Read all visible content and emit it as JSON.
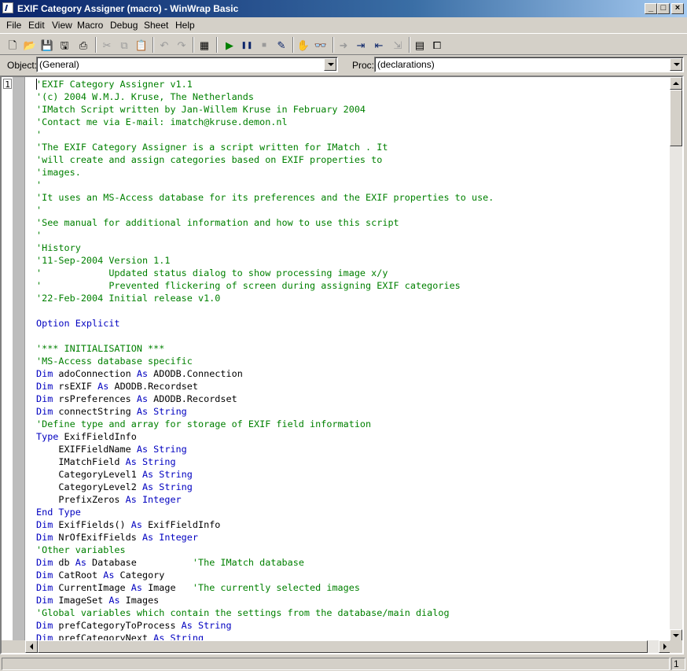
{
  "window": {
    "title": "EXIF Category Assigner (macro) - WinWrap Basic",
    "minimize_glyph": "_",
    "maximize_glyph": "□",
    "close_glyph": "×"
  },
  "menu": [
    "File",
    "Edit",
    "View",
    "Macro",
    "Debug",
    "Sheet",
    "Help"
  ],
  "toolbar": [
    {
      "icon": "new-file-icon",
      "glyph": "🗋",
      "enabled": true
    },
    {
      "icon": "open-folder-icon",
      "glyph": "📂",
      "enabled": true
    },
    {
      "icon": "save-icon",
      "glyph": "💾",
      "enabled": true
    },
    {
      "icon": "save-all-icon",
      "glyph": "🖫",
      "enabled": true
    },
    {
      "icon": "print-icon",
      "glyph": "⎙",
      "enabled": true
    },
    {
      "icon": "cut-icon",
      "glyph": "✂",
      "enabled": false
    },
    {
      "icon": "copy-icon",
      "glyph": "⧉",
      "enabled": false
    },
    {
      "icon": "paste-icon",
      "glyph": "📋",
      "enabled": false
    },
    {
      "icon": "undo-icon",
      "glyph": "↶",
      "enabled": false
    },
    {
      "icon": "redo-icon",
      "glyph": "↷",
      "enabled": false
    },
    {
      "icon": "user-dialog-icon",
      "glyph": "▦",
      "enabled": true
    },
    {
      "icon": "run-icon",
      "glyph": "▶",
      "enabled": true
    },
    {
      "icon": "pause-icon",
      "glyph": "❚❚",
      "enabled": true
    },
    {
      "icon": "stop-icon",
      "glyph": "■",
      "enabled": false
    },
    {
      "icon": "toggle-breakpoint-icon",
      "glyph": "✎",
      "enabled": true
    },
    {
      "icon": "hand-icon",
      "glyph": "✋",
      "enabled": true
    },
    {
      "icon": "quick-watch-icon",
      "glyph": "👓",
      "enabled": true
    },
    {
      "icon": "step-into-icon",
      "glyph": "➜",
      "enabled": false
    },
    {
      "icon": "step-over-icon",
      "glyph": "⇥",
      "enabled": true
    },
    {
      "icon": "step-out-icon",
      "glyph": "⇤",
      "enabled": true
    },
    {
      "icon": "step-to-cursor-icon",
      "glyph": "⇲",
      "enabled": false
    },
    {
      "icon": "dialog-editor-icon",
      "glyph": "▤",
      "enabled": true
    },
    {
      "icon": "references-icon",
      "glyph": "⧠",
      "enabled": true
    }
  ],
  "selectors": {
    "object_label": "Object:",
    "object_value": "(General)",
    "proc_label": "Proc:",
    "proc_value": "(declarations)"
  },
  "editor": {
    "line_number": "1",
    "lines": [
      [
        {
          "t": "'EXIF Category Assigner v1.1",
          "c": "cm"
        }
      ],
      [
        {
          "t": "'(c) 2004 W.M.J. Kruse, The Netherlands",
          "c": "cm"
        }
      ],
      [
        {
          "t": "'IMatch Script written by Jan-Willem Kruse in February 2004",
          "c": "cm"
        }
      ],
      [
        {
          "t": "'Contact me via E-mail: imatch@kruse.demon.nl",
          "c": "cm"
        }
      ],
      [
        {
          "t": "'",
          "c": "cm"
        }
      ],
      [
        {
          "t": "'The EXIF Category Assigner is a script written for IMatch . It",
          "c": "cm"
        }
      ],
      [
        {
          "t": "'will create and assign categories based on EXIF properties to",
          "c": "cm"
        }
      ],
      [
        {
          "t": "'images.",
          "c": "cm"
        }
      ],
      [
        {
          "t": "'",
          "c": "cm"
        }
      ],
      [
        {
          "t": "'It uses an MS-Access database for its preferences and the EXIF properties to use.",
          "c": "cm"
        }
      ],
      [
        {
          "t": "'",
          "c": "cm"
        }
      ],
      [
        {
          "t": "'See manual for additional information and how to use this script",
          "c": "cm"
        }
      ],
      [
        {
          "t": "'",
          "c": "cm"
        }
      ],
      [
        {
          "t": "'History",
          "c": "cm"
        }
      ],
      [
        {
          "t": "'11-Sep-2004 Version 1.1",
          "c": "cm"
        }
      ],
      [
        {
          "t": "'            Updated status dialog to show processing image x/y",
          "c": "cm"
        }
      ],
      [
        {
          "t": "'            Prevented flickering of screen during assigning EXIF categories",
          "c": "cm"
        }
      ],
      [
        {
          "t": "'22-Feb-2004 Initial release v1.0",
          "c": "cm"
        }
      ],
      [],
      [
        {
          "t": "Option Explicit",
          "c": "kw"
        }
      ],
      [],
      [
        {
          "t": "'*** INITIALISATION ***",
          "c": "cm"
        }
      ],
      [
        {
          "t": "'MS-Access database specific",
          "c": "cm"
        }
      ],
      [
        {
          "t": "Dim",
          "c": "kw"
        },
        {
          "t": " adoConnection ",
          "c": "tx"
        },
        {
          "t": "As",
          "c": "kw"
        },
        {
          "t": " ADODB.Connection",
          "c": "tx"
        }
      ],
      [
        {
          "t": "Dim",
          "c": "kw"
        },
        {
          "t": " rsEXIF ",
          "c": "tx"
        },
        {
          "t": "As",
          "c": "kw"
        },
        {
          "t": " ADODB.Recordset",
          "c": "tx"
        }
      ],
      [
        {
          "t": "Dim",
          "c": "kw"
        },
        {
          "t": " rsPreferences ",
          "c": "tx"
        },
        {
          "t": "As",
          "c": "kw"
        },
        {
          "t": " ADODB.Recordset",
          "c": "tx"
        }
      ],
      [
        {
          "t": "Dim",
          "c": "kw"
        },
        {
          "t": " connectString ",
          "c": "tx"
        },
        {
          "t": "As String",
          "c": "kw"
        }
      ],
      [
        {
          "t": "'Define type and array for storage of EXIF field information",
          "c": "cm"
        }
      ],
      [
        {
          "t": "Type",
          "c": "kw"
        },
        {
          "t": " ExifFieldInfo",
          "c": "tx"
        }
      ],
      [
        {
          "t": "    EXIFFieldName ",
          "c": "tx"
        },
        {
          "t": "As String",
          "c": "kw"
        }
      ],
      [
        {
          "t": "    IMatchField ",
          "c": "tx"
        },
        {
          "t": "As String",
          "c": "kw"
        }
      ],
      [
        {
          "t": "    CategoryLevel1 ",
          "c": "tx"
        },
        {
          "t": "As String",
          "c": "kw"
        }
      ],
      [
        {
          "t": "    CategoryLevel2 ",
          "c": "tx"
        },
        {
          "t": "As String",
          "c": "kw"
        }
      ],
      [
        {
          "t": "    PrefixZeros ",
          "c": "tx"
        },
        {
          "t": "As Integer",
          "c": "kw"
        }
      ],
      [
        {
          "t": "End Type",
          "c": "kw"
        }
      ],
      [
        {
          "t": "Dim",
          "c": "kw"
        },
        {
          "t": " ExifFields() ",
          "c": "tx"
        },
        {
          "t": "As",
          "c": "kw"
        },
        {
          "t": " ExifFieldInfo",
          "c": "tx"
        }
      ],
      [
        {
          "t": "Dim",
          "c": "kw"
        },
        {
          "t": " NrOfExifFields ",
          "c": "tx"
        },
        {
          "t": "As Integer",
          "c": "kw"
        }
      ],
      [
        {
          "t": "'Other variables",
          "c": "cm"
        }
      ],
      [
        {
          "t": "Dim",
          "c": "kw"
        },
        {
          "t": " db ",
          "c": "tx"
        },
        {
          "t": "As",
          "c": "kw"
        },
        {
          "t": " Database          ",
          "c": "tx"
        },
        {
          "t": "'The IMatch database",
          "c": "cm"
        }
      ],
      [
        {
          "t": "Dim",
          "c": "kw"
        },
        {
          "t": " CatRoot ",
          "c": "tx"
        },
        {
          "t": "As",
          "c": "kw"
        },
        {
          "t": " Category",
          "c": "tx"
        }
      ],
      [
        {
          "t": "Dim",
          "c": "kw"
        },
        {
          "t": " CurrentImage ",
          "c": "tx"
        },
        {
          "t": "As",
          "c": "kw"
        },
        {
          "t": " Image   ",
          "c": "tx"
        },
        {
          "t": "'The currently selected images",
          "c": "cm"
        }
      ],
      [
        {
          "t": "Dim",
          "c": "kw"
        },
        {
          "t": " ImageSet ",
          "c": "tx"
        },
        {
          "t": "As",
          "c": "kw"
        },
        {
          "t": " Images",
          "c": "tx"
        }
      ],
      [
        {
          "t": "'Global variables which contain the settings from the database/main dialog",
          "c": "cm"
        }
      ],
      [
        {
          "t": "Dim",
          "c": "kw"
        },
        {
          "t": " prefCategoryToProcess ",
          "c": "tx"
        },
        {
          "t": "As String",
          "c": "kw"
        }
      ],
      [
        {
          "t": "Dim",
          "c": "kw"
        },
        {
          "t": " prefCategoryNext ",
          "c": "tx"
        },
        {
          "t": "As String",
          "c": "kw"
        }
      ]
    ]
  },
  "statusbar": {
    "line_indicator": "1"
  },
  "colors": {
    "comment": "#008000",
    "keyword": "#0000c0",
    "identifier": "#000000",
    "title_bar": "#0a246a"
  }
}
